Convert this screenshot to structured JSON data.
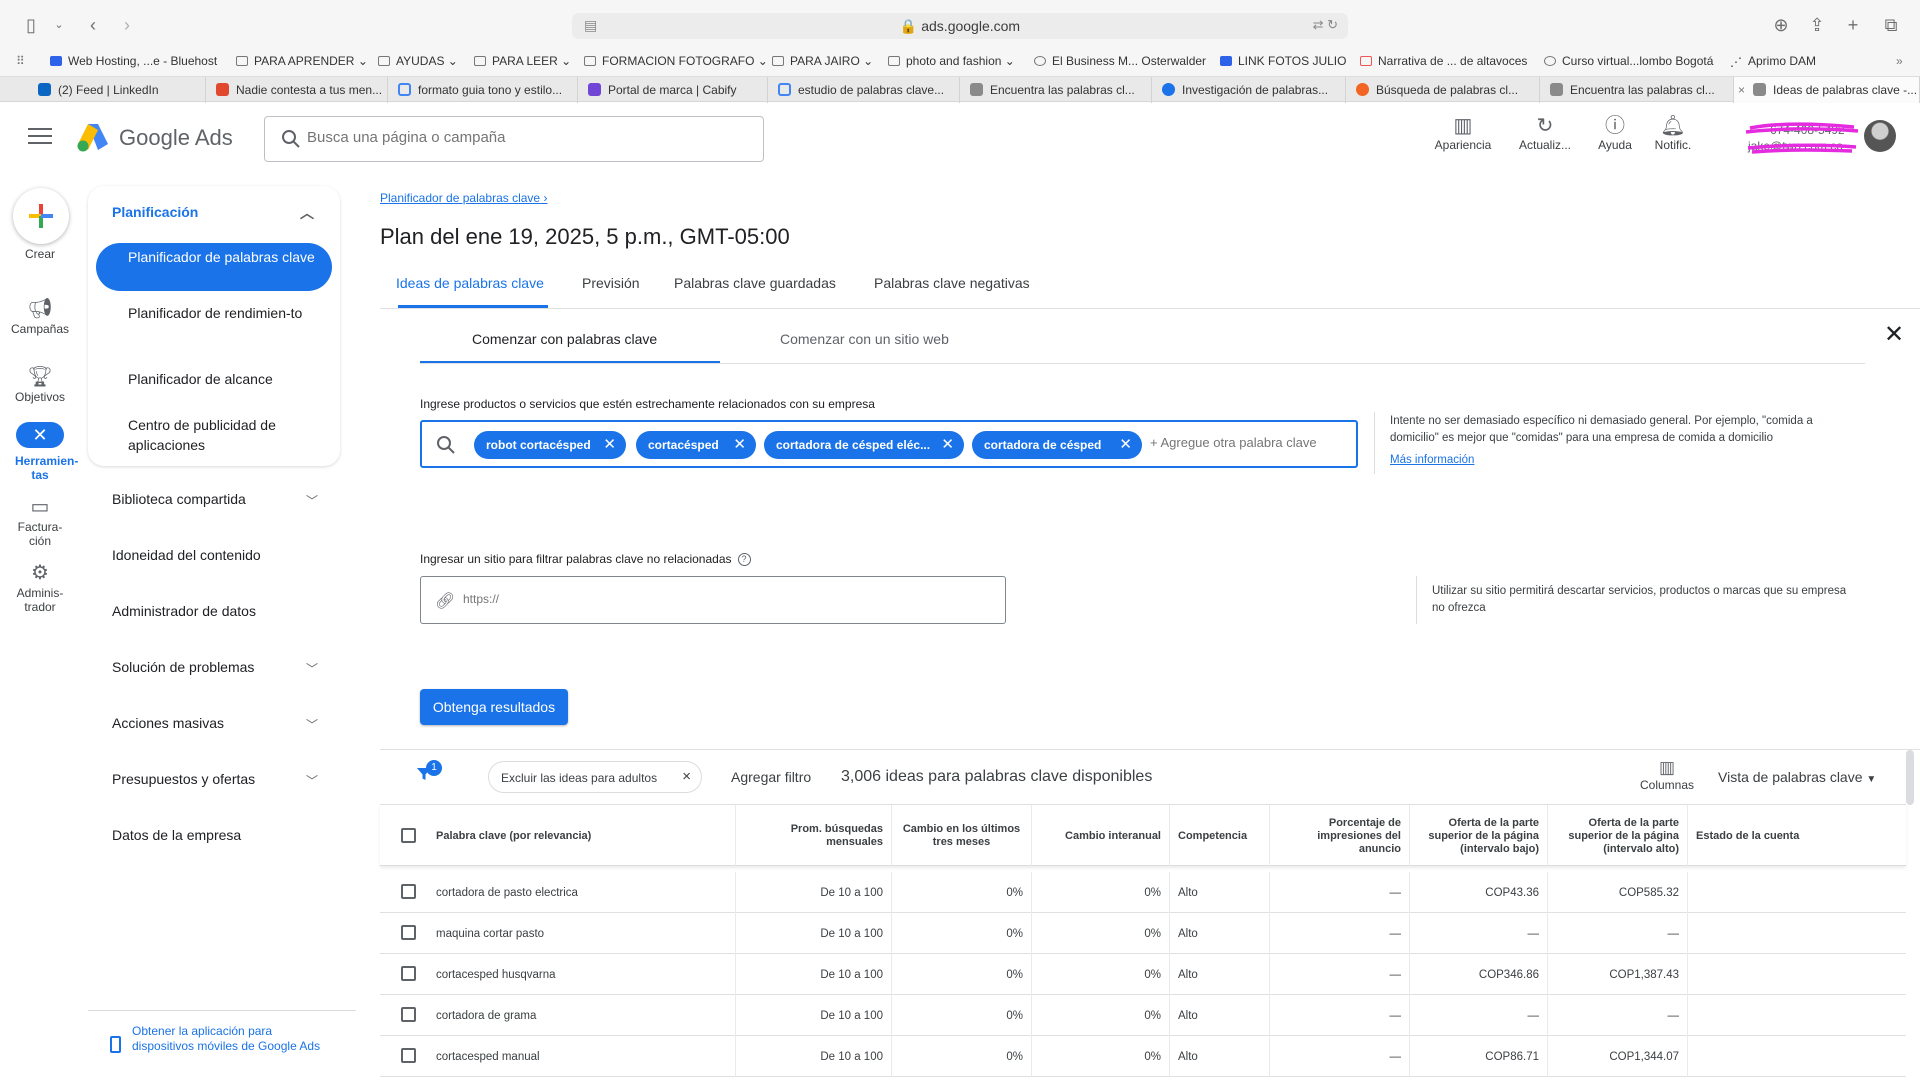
{
  "browser": {
    "url": "ads.google.com",
    "bookmarks": [
      "Web Hosting, ...e - Bluehost",
      "PARA APRENDER",
      "AYUDAS",
      "PARA LEER",
      "FORMACION FOTOGRAFO",
      "PARA JAIRO",
      "photo and fashion",
      "El Business M... Osterwalder",
      "LINK FOTOS JULIO",
      "Narrativa de ... de altavoces",
      "Curso virtual...lombo Bogotá",
      "Aprimo DAM"
    ],
    "tabs": [
      "(2) Feed | LinkedIn",
      "Nadie contesta a tus men...",
      "formato guia tono y estilo...",
      "Portal de marca | Cabify",
      "estudio de palabras clave...",
      "Encuentra las palabras cl...",
      "Investigación de palabras...",
      "Búsqueda de palabras cl...",
      "Encuentra las palabras cl...",
      "Ideas de palabras clave -..."
    ]
  },
  "header": {
    "brand": "Google Ads",
    "search_placeholder": "Busca una página o campaña",
    "actions": [
      "Apariencia",
      "Actualiz...",
      "Ayuda",
      "Notific."
    ],
    "account_phone": "674-408-5492",
    "account_email": "jake@two.com.co"
  },
  "rail": {
    "crear": "Crear",
    "items": [
      "Campañas",
      "Objetivos",
      "Herramien-tas",
      "Factura-ción",
      "Adminis-trador"
    ]
  },
  "nav": {
    "section": "Planificación",
    "selected": "Planificador de palabras clave",
    "subitems": [
      "Planificador de rendimien-to",
      "Planificador de alcance",
      "Centro de publicidad de aplicaciones"
    ],
    "items": [
      "Biblioteca compartida",
      "Idoneidad del contenido",
      "Administrador de datos",
      "Solución de problemas",
      "Acciones masivas",
      "Presupuestos y ofertas",
      "Datos de la empresa"
    ],
    "app_link": "Obtener la aplicación para dispositivos móviles de Google Ads"
  },
  "main": {
    "breadcrumb": "Planificador de palabras clave",
    "title": "Plan del ene 19, 2025, 5 p.m., GMT-05:00",
    "tabs": [
      "Ideas de palabras clave",
      "Previsión",
      "Palabras clave guardadas",
      "Palabras clave negativas"
    ],
    "subtabs": [
      "Comenzar con palabras clave",
      "Comenzar con un sitio web"
    ],
    "kw_label": "Ingrese productos o servicios que estén estrechamente relacionados con su empresa",
    "chips": [
      "robot cortacésped",
      "cortacésped",
      "cortadora de césped eléc...",
      "cortadora de césped"
    ],
    "kw_placeholder": "+ Agregue otra palabra clave",
    "hint": "Intente no ser demasiado específico ni demasiado general. Por ejemplo, \"comida a domicilio\" es mejor que \"comidas\" para una empresa de comida a domicilio",
    "hint_link": "Más información",
    "site_label": "Ingresar un sitio para filtrar palabras clave no relacionadas",
    "site_placeholder": "https://",
    "site_hint": "Utilizar su sitio permitirá descartar servicios, productos o marcas que su empresa no ofrezca",
    "submit": "Obtenga resultados"
  },
  "results": {
    "filter_badge": "1",
    "filter_chip": "Excluir las ideas para adultos",
    "add_filter": "Agregar filtro",
    "count": "3,006 ideas para palabras clave disponibles",
    "columns": "Columnas",
    "view": "Vista de palabras clave"
  },
  "table": {
    "headers": [
      "Palabra clave (por relevancia)",
      "Prom. búsquedas mensuales",
      "Cambio en los últimos tres meses",
      "Cambio interanual",
      "Competencia",
      "Porcentaje de impresiones del anuncio",
      "Oferta de la parte superior de la página (intervalo bajo)",
      "Oferta de la parte superior de la página (intervalo alto)",
      "Estado de la cuenta"
    ],
    "rows": [
      [
        "cortadora de pasto electrica",
        "De 10 a 100",
        "0%",
        "0%",
        "Alto",
        "—",
        "COP43.36",
        "COP585.32",
        ""
      ],
      [
        "maquina cortar pasto",
        "De 10 a 100",
        "0%",
        "0%",
        "Alto",
        "—",
        "—",
        "—",
        ""
      ],
      [
        "cortacesped husqvarna",
        "De 10 a 100",
        "0%",
        "0%",
        "Alto",
        "—",
        "COP346.86",
        "COP1,387.43",
        ""
      ],
      [
        "cortadora de grama",
        "De 10 a 100",
        "0%",
        "0%",
        "Alto",
        "—",
        "—",
        "—",
        ""
      ],
      [
        "cortacesped manual",
        "De 10 a 100",
        "0%",
        "0%",
        "Alto",
        "—",
        "COP86.71",
        "COP1,344.07",
        ""
      ]
    ]
  }
}
